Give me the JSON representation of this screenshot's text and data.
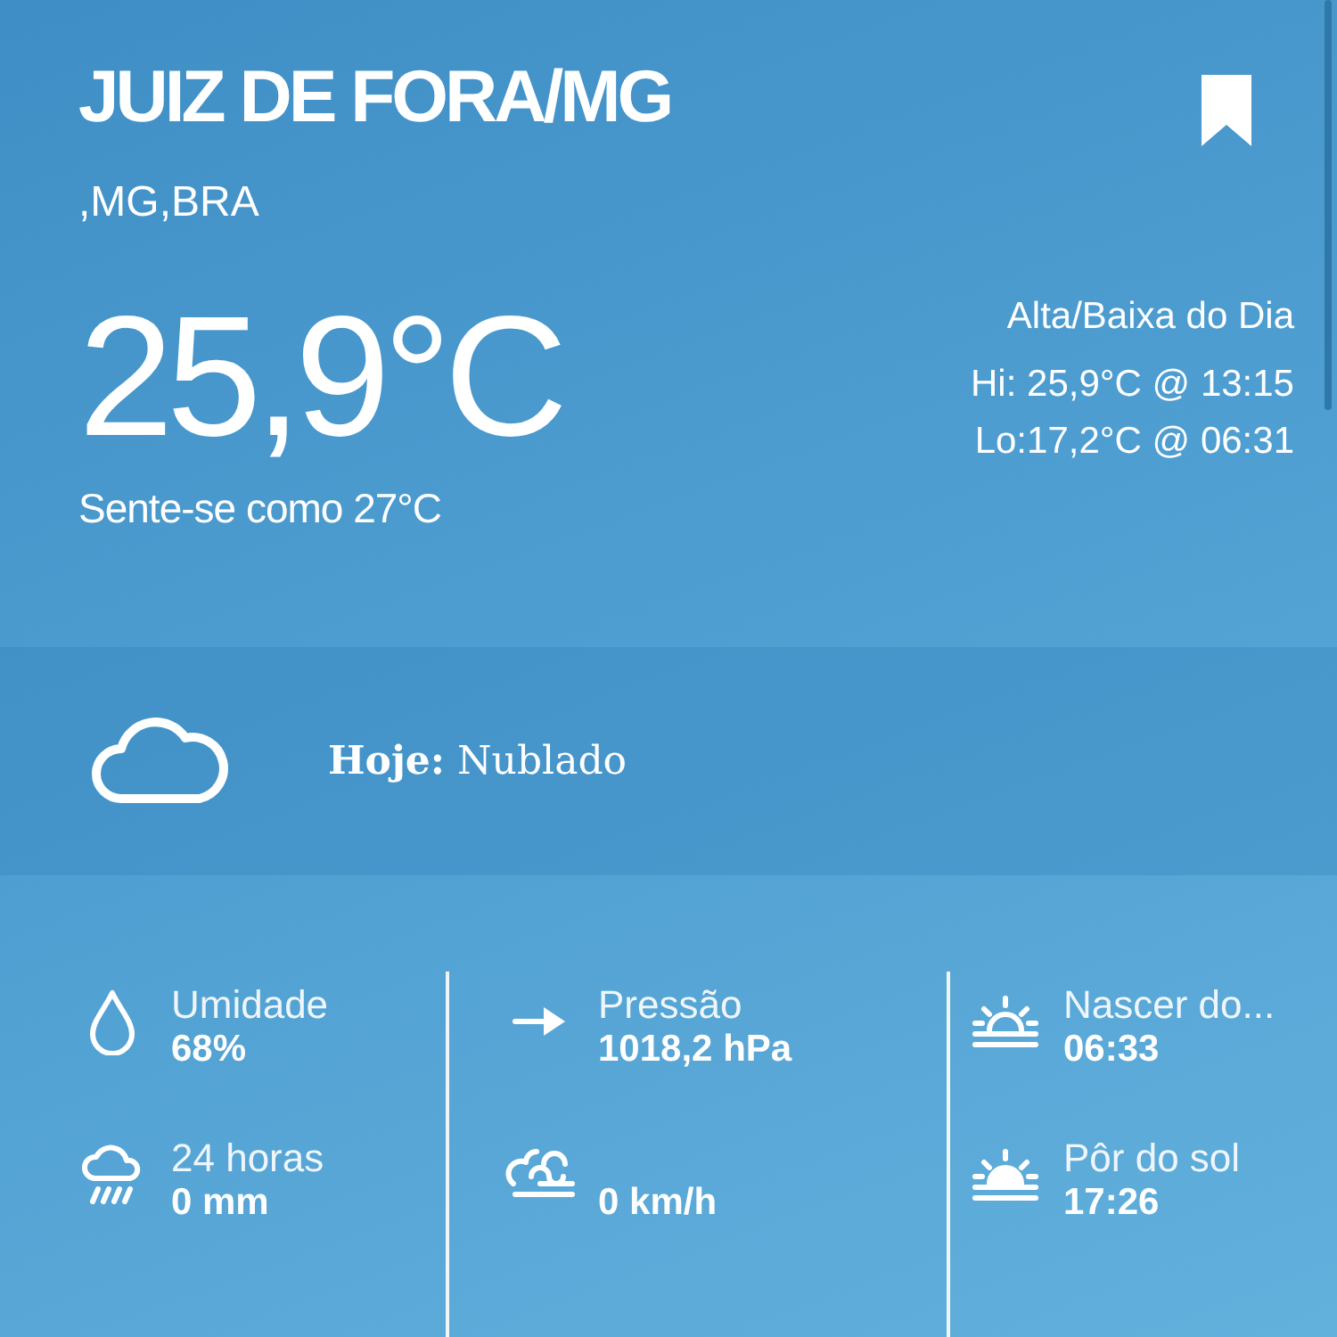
{
  "location": {
    "city": "JUIZ DE FORA/MG",
    "region": ",MG,BRA",
    "bookmarked": true
  },
  "current": {
    "temperature": "25,9°C",
    "feels_like": "Sente-se como 27°C"
  },
  "high_low": {
    "title": "Alta/Baixa do Dia",
    "high": "Hi: 25,9°C @ 13:15",
    "low": "Lo:17,2°C @ 06:31"
  },
  "condition": {
    "kind": "cloudy",
    "label": "Hoje:",
    "value": "Nublado"
  },
  "stats": [
    [
      {
        "kind": "humidity",
        "label": "Umidade",
        "value": "68%"
      },
      {
        "kind": "rain",
        "label": "24 horas",
        "value": "0 mm"
      }
    ],
    [
      {
        "kind": "pressure",
        "label": "Pressão",
        "value": "1018,2 hPa"
      },
      {
        "kind": "wind",
        "value": "0 km/h"
      }
    ],
    [
      {
        "kind": "sunrise",
        "label": "Nascer do...",
        "value": "06:33"
      },
      {
        "kind": "sunset",
        "label": "Pôr do sol",
        "value": "17:26"
      }
    ]
  ]
}
